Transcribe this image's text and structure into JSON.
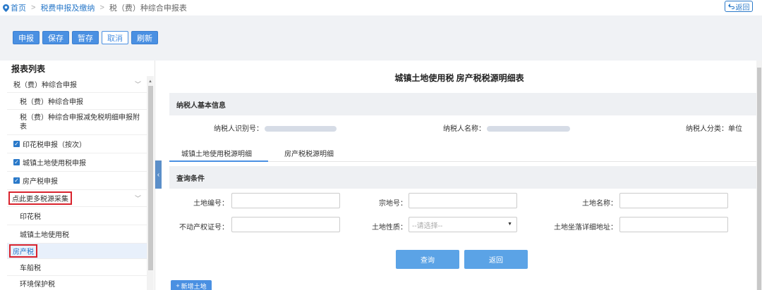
{
  "breadcrumb": {
    "home": "首页",
    "level1": "税费申报及缴纳",
    "level2": "税（费）种综合申报表"
  },
  "top_back_label": "返回",
  "toolbar": {
    "declare": "申报",
    "save": "保存",
    "temp_save": "暂存",
    "cancel": "取消",
    "refresh": "刷新"
  },
  "sidebar": {
    "title": "报表列表",
    "items": [
      {
        "label": "税（费）种综合申报"
      },
      {
        "label": "税（费）种综合申报"
      },
      {
        "label": "税（费）种综合申报减免税明细申报附表"
      },
      {
        "label": "印花税申报（按次）"
      },
      {
        "label": "城镇土地使用税申报"
      },
      {
        "label": "房产税申报"
      },
      {
        "label": "点此更多税源采集"
      },
      {
        "label": "印花税"
      },
      {
        "label": "城镇土地使用税"
      },
      {
        "label": "房产税"
      },
      {
        "label": "车船税"
      },
      {
        "label": "环境保护税"
      }
    ]
  },
  "main": {
    "title": "城镇土地使用税  房产税税源明细表",
    "taxpayer_section": "纳税人基本信息",
    "taxpayer_id_label": "纳税人识别号：",
    "taxpayer_name_label": "纳税人名称：",
    "taxpayer_type_label": "纳税人分类：单位",
    "tabs": [
      "城镇土地使用税源明细",
      "房产税税源明细"
    ],
    "query_section": "查询条件",
    "fields": {
      "land_no": "土地编号：",
      "parcel_no": "宗地号：",
      "land_name": "土地名称：",
      "property_cert": "不动产权证号：",
      "land_nature": "土地性质：",
      "land_address": "土地坐落详细地址："
    },
    "land_nature_placeholder": "--请选择--",
    "query_button": "查询",
    "return_button": "返回",
    "add_land_button": "新增土地"
  }
}
